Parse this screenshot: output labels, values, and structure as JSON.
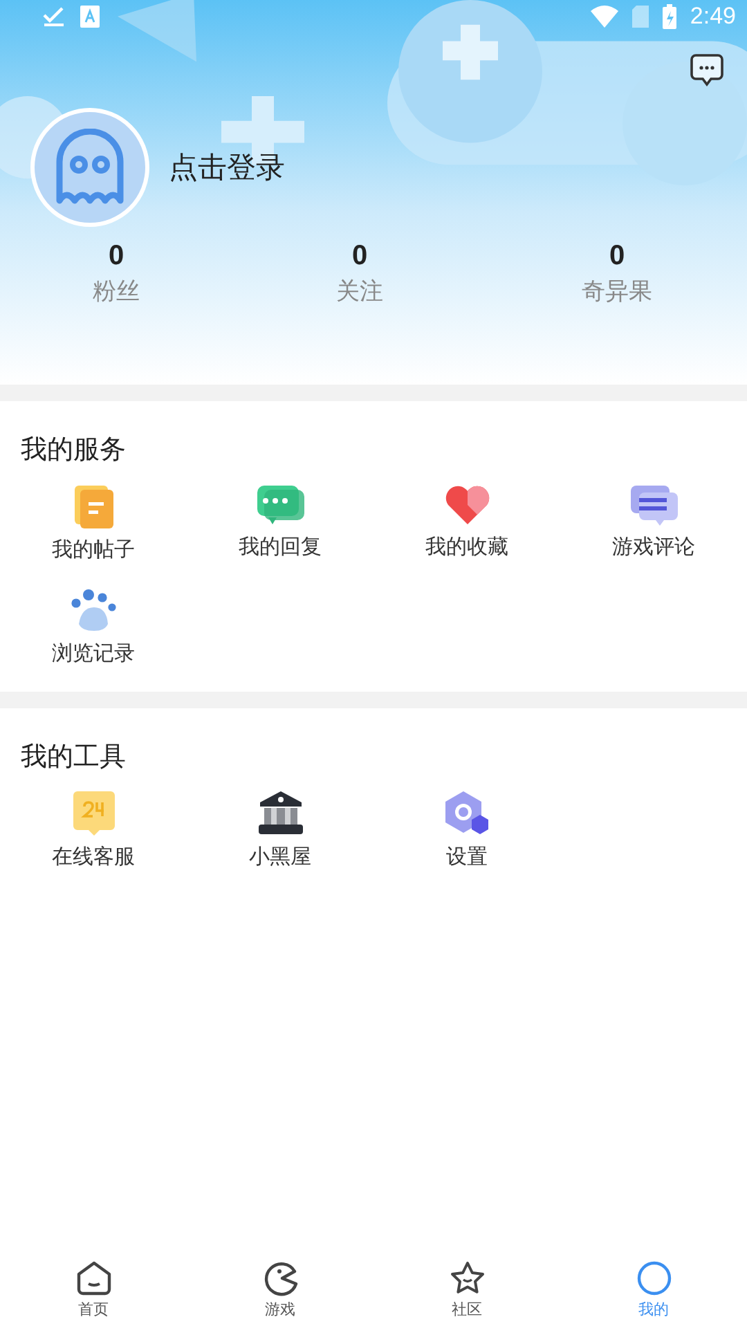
{
  "status_bar": {
    "time": "2:49"
  },
  "profile": {
    "login_text": "点击登录"
  },
  "stats": [
    {
      "value": "0",
      "label": "粉丝"
    },
    {
      "value": "0",
      "label": "关注"
    },
    {
      "value": "0",
      "label": "奇异果"
    }
  ],
  "services": {
    "title": "我的服务",
    "items": [
      {
        "kind": "posts",
        "label": "我的帖子"
      },
      {
        "kind": "replies",
        "label": "我的回复"
      },
      {
        "kind": "favorites",
        "label": "我的收藏"
      },
      {
        "kind": "reviews",
        "label": "游戏评论"
      },
      {
        "kind": "history",
        "label": "浏览记录"
      }
    ]
  },
  "tools": {
    "title": "我的工具",
    "items": [
      {
        "kind": "support",
        "label": "在线客服"
      },
      {
        "kind": "blackroom",
        "label": "小黑屋"
      },
      {
        "kind": "settings",
        "label": "设置"
      }
    ]
  },
  "tab_bar": [
    {
      "kind": "home",
      "label": "首页",
      "selected": false
    },
    {
      "kind": "games",
      "label": "游戏",
      "selected": false
    },
    {
      "kind": "community",
      "label": "社区",
      "selected": false
    },
    {
      "kind": "me",
      "label": "我的",
      "selected": true
    }
  ]
}
